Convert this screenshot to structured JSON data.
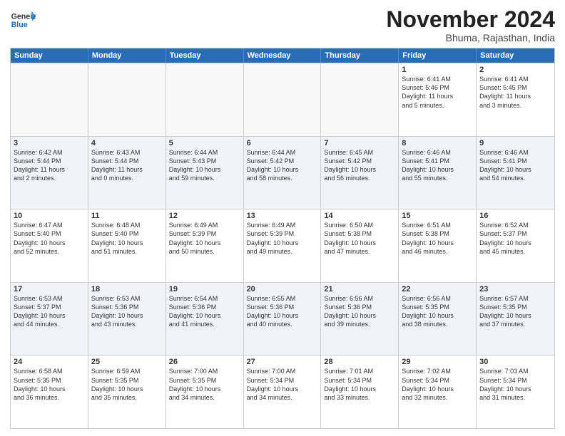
{
  "header": {
    "logo_general": "General",
    "logo_blue": "Blue",
    "month_title": "November 2024",
    "location": "Bhuma, Rajasthan, India"
  },
  "weekdays": [
    "Sunday",
    "Monday",
    "Tuesday",
    "Wednesday",
    "Thursday",
    "Friday",
    "Saturday"
  ],
  "rows": [
    [
      {
        "day": "",
        "text": "",
        "empty": true
      },
      {
        "day": "",
        "text": "",
        "empty": true
      },
      {
        "day": "",
        "text": "",
        "empty": true
      },
      {
        "day": "",
        "text": "",
        "empty": true
      },
      {
        "day": "",
        "text": "",
        "empty": true
      },
      {
        "day": "1",
        "text": "Sunrise: 6:41 AM\nSunset: 5:46 PM\nDaylight: 11 hours\nand 5 minutes.",
        "empty": false
      },
      {
        "day": "2",
        "text": "Sunrise: 6:41 AM\nSunset: 5:45 PM\nDaylight: 11 hours\nand 3 minutes.",
        "empty": false
      }
    ],
    [
      {
        "day": "3",
        "text": "Sunrise: 6:42 AM\nSunset: 5:44 PM\nDaylight: 11 hours\nand 2 minutes.",
        "empty": false
      },
      {
        "day": "4",
        "text": "Sunrise: 6:43 AM\nSunset: 5:44 PM\nDaylight: 11 hours\nand 0 minutes.",
        "empty": false
      },
      {
        "day": "5",
        "text": "Sunrise: 6:44 AM\nSunset: 5:43 PM\nDaylight: 10 hours\nand 59 minutes.",
        "empty": false
      },
      {
        "day": "6",
        "text": "Sunrise: 6:44 AM\nSunset: 5:42 PM\nDaylight: 10 hours\nand 58 minutes.",
        "empty": false
      },
      {
        "day": "7",
        "text": "Sunrise: 6:45 AM\nSunset: 5:42 PM\nDaylight: 10 hours\nand 56 minutes.",
        "empty": false
      },
      {
        "day": "8",
        "text": "Sunrise: 6:46 AM\nSunset: 5:41 PM\nDaylight: 10 hours\nand 55 minutes.",
        "empty": false
      },
      {
        "day": "9",
        "text": "Sunrise: 6:46 AM\nSunset: 5:41 PM\nDaylight: 10 hours\nand 54 minutes.",
        "empty": false
      }
    ],
    [
      {
        "day": "10",
        "text": "Sunrise: 6:47 AM\nSunset: 5:40 PM\nDaylight: 10 hours\nand 52 minutes.",
        "empty": false
      },
      {
        "day": "11",
        "text": "Sunrise: 6:48 AM\nSunset: 5:40 PM\nDaylight: 10 hours\nand 51 minutes.",
        "empty": false
      },
      {
        "day": "12",
        "text": "Sunrise: 6:49 AM\nSunset: 5:39 PM\nDaylight: 10 hours\nand 50 minutes.",
        "empty": false
      },
      {
        "day": "13",
        "text": "Sunrise: 6:49 AM\nSunset: 5:39 PM\nDaylight: 10 hours\nand 49 minutes.",
        "empty": false
      },
      {
        "day": "14",
        "text": "Sunrise: 6:50 AM\nSunset: 5:38 PM\nDaylight: 10 hours\nand 47 minutes.",
        "empty": false
      },
      {
        "day": "15",
        "text": "Sunrise: 6:51 AM\nSunset: 5:38 PM\nDaylight: 10 hours\nand 46 minutes.",
        "empty": false
      },
      {
        "day": "16",
        "text": "Sunrise: 6:52 AM\nSunset: 5:37 PM\nDaylight: 10 hours\nand 45 minutes.",
        "empty": false
      }
    ],
    [
      {
        "day": "17",
        "text": "Sunrise: 6:53 AM\nSunset: 5:37 PM\nDaylight: 10 hours\nand 44 minutes.",
        "empty": false
      },
      {
        "day": "18",
        "text": "Sunrise: 6:53 AM\nSunset: 5:36 PM\nDaylight: 10 hours\nand 43 minutes.",
        "empty": false
      },
      {
        "day": "19",
        "text": "Sunrise: 6:54 AM\nSunset: 5:36 PM\nDaylight: 10 hours\nand 41 minutes.",
        "empty": false
      },
      {
        "day": "20",
        "text": "Sunrise: 6:55 AM\nSunset: 5:36 PM\nDaylight: 10 hours\nand 40 minutes.",
        "empty": false
      },
      {
        "day": "21",
        "text": "Sunrise: 6:56 AM\nSunset: 5:36 PM\nDaylight: 10 hours\nand 39 minutes.",
        "empty": false
      },
      {
        "day": "22",
        "text": "Sunrise: 6:56 AM\nSunset: 5:35 PM\nDaylight: 10 hours\nand 38 minutes.",
        "empty": false
      },
      {
        "day": "23",
        "text": "Sunrise: 6:57 AM\nSunset: 5:35 PM\nDaylight: 10 hours\nand 37 minutes.",
        "empty": false
      }
    ],
    [
      {
        "day": "24",
        "text": "Sunrise: 6:58 AM\nSunset: 5:35 PM\nDaylight: 10 hours\nand 36 minutes.",
        "empty": false
      },
      {
        "day": "25",
        "text": "Sunrise: 6:59 AM\nSunset: 5:35 PM\nDaylight: 10 hours\nand 35 minutes.",
        "empty": false
      },
      {
        "day": "26",
        "text": "Sunrise: 7:00 AM\nSunset: 5:35 PM\nDaylight: 10 hours\nand 34 minutes.",
        "empty": false
      },
      {
        "day": "27",
        "text": "Sunrise: 7:00 AM\nSunset: 5:34 PM\nDaylight: 10 hours\nand 34 minutes.",
        "empty": false
      },
      {
        "day": "28",
        "text": "Sunrise: 7:01 AM\nSunset: 5:34 PM\nDaylight: 10 hours\nand 33 minutes.",
        "empty": false
      },
      {
        "day": "29",
        "text": "Sunrise: 7:02 AM\nSunset: 5:34 PM\nDaylight: 10 hours\nand 32 minutes.",
        "empty": false
      },
      {
        "day": "30",
        "text": "Sunrise: 7:03 AM\nSunset: 5:34 PM\nDaylight: 10 hours\nand 31 minutes.",
        "empty": false
      }
    ]
  ]
}
